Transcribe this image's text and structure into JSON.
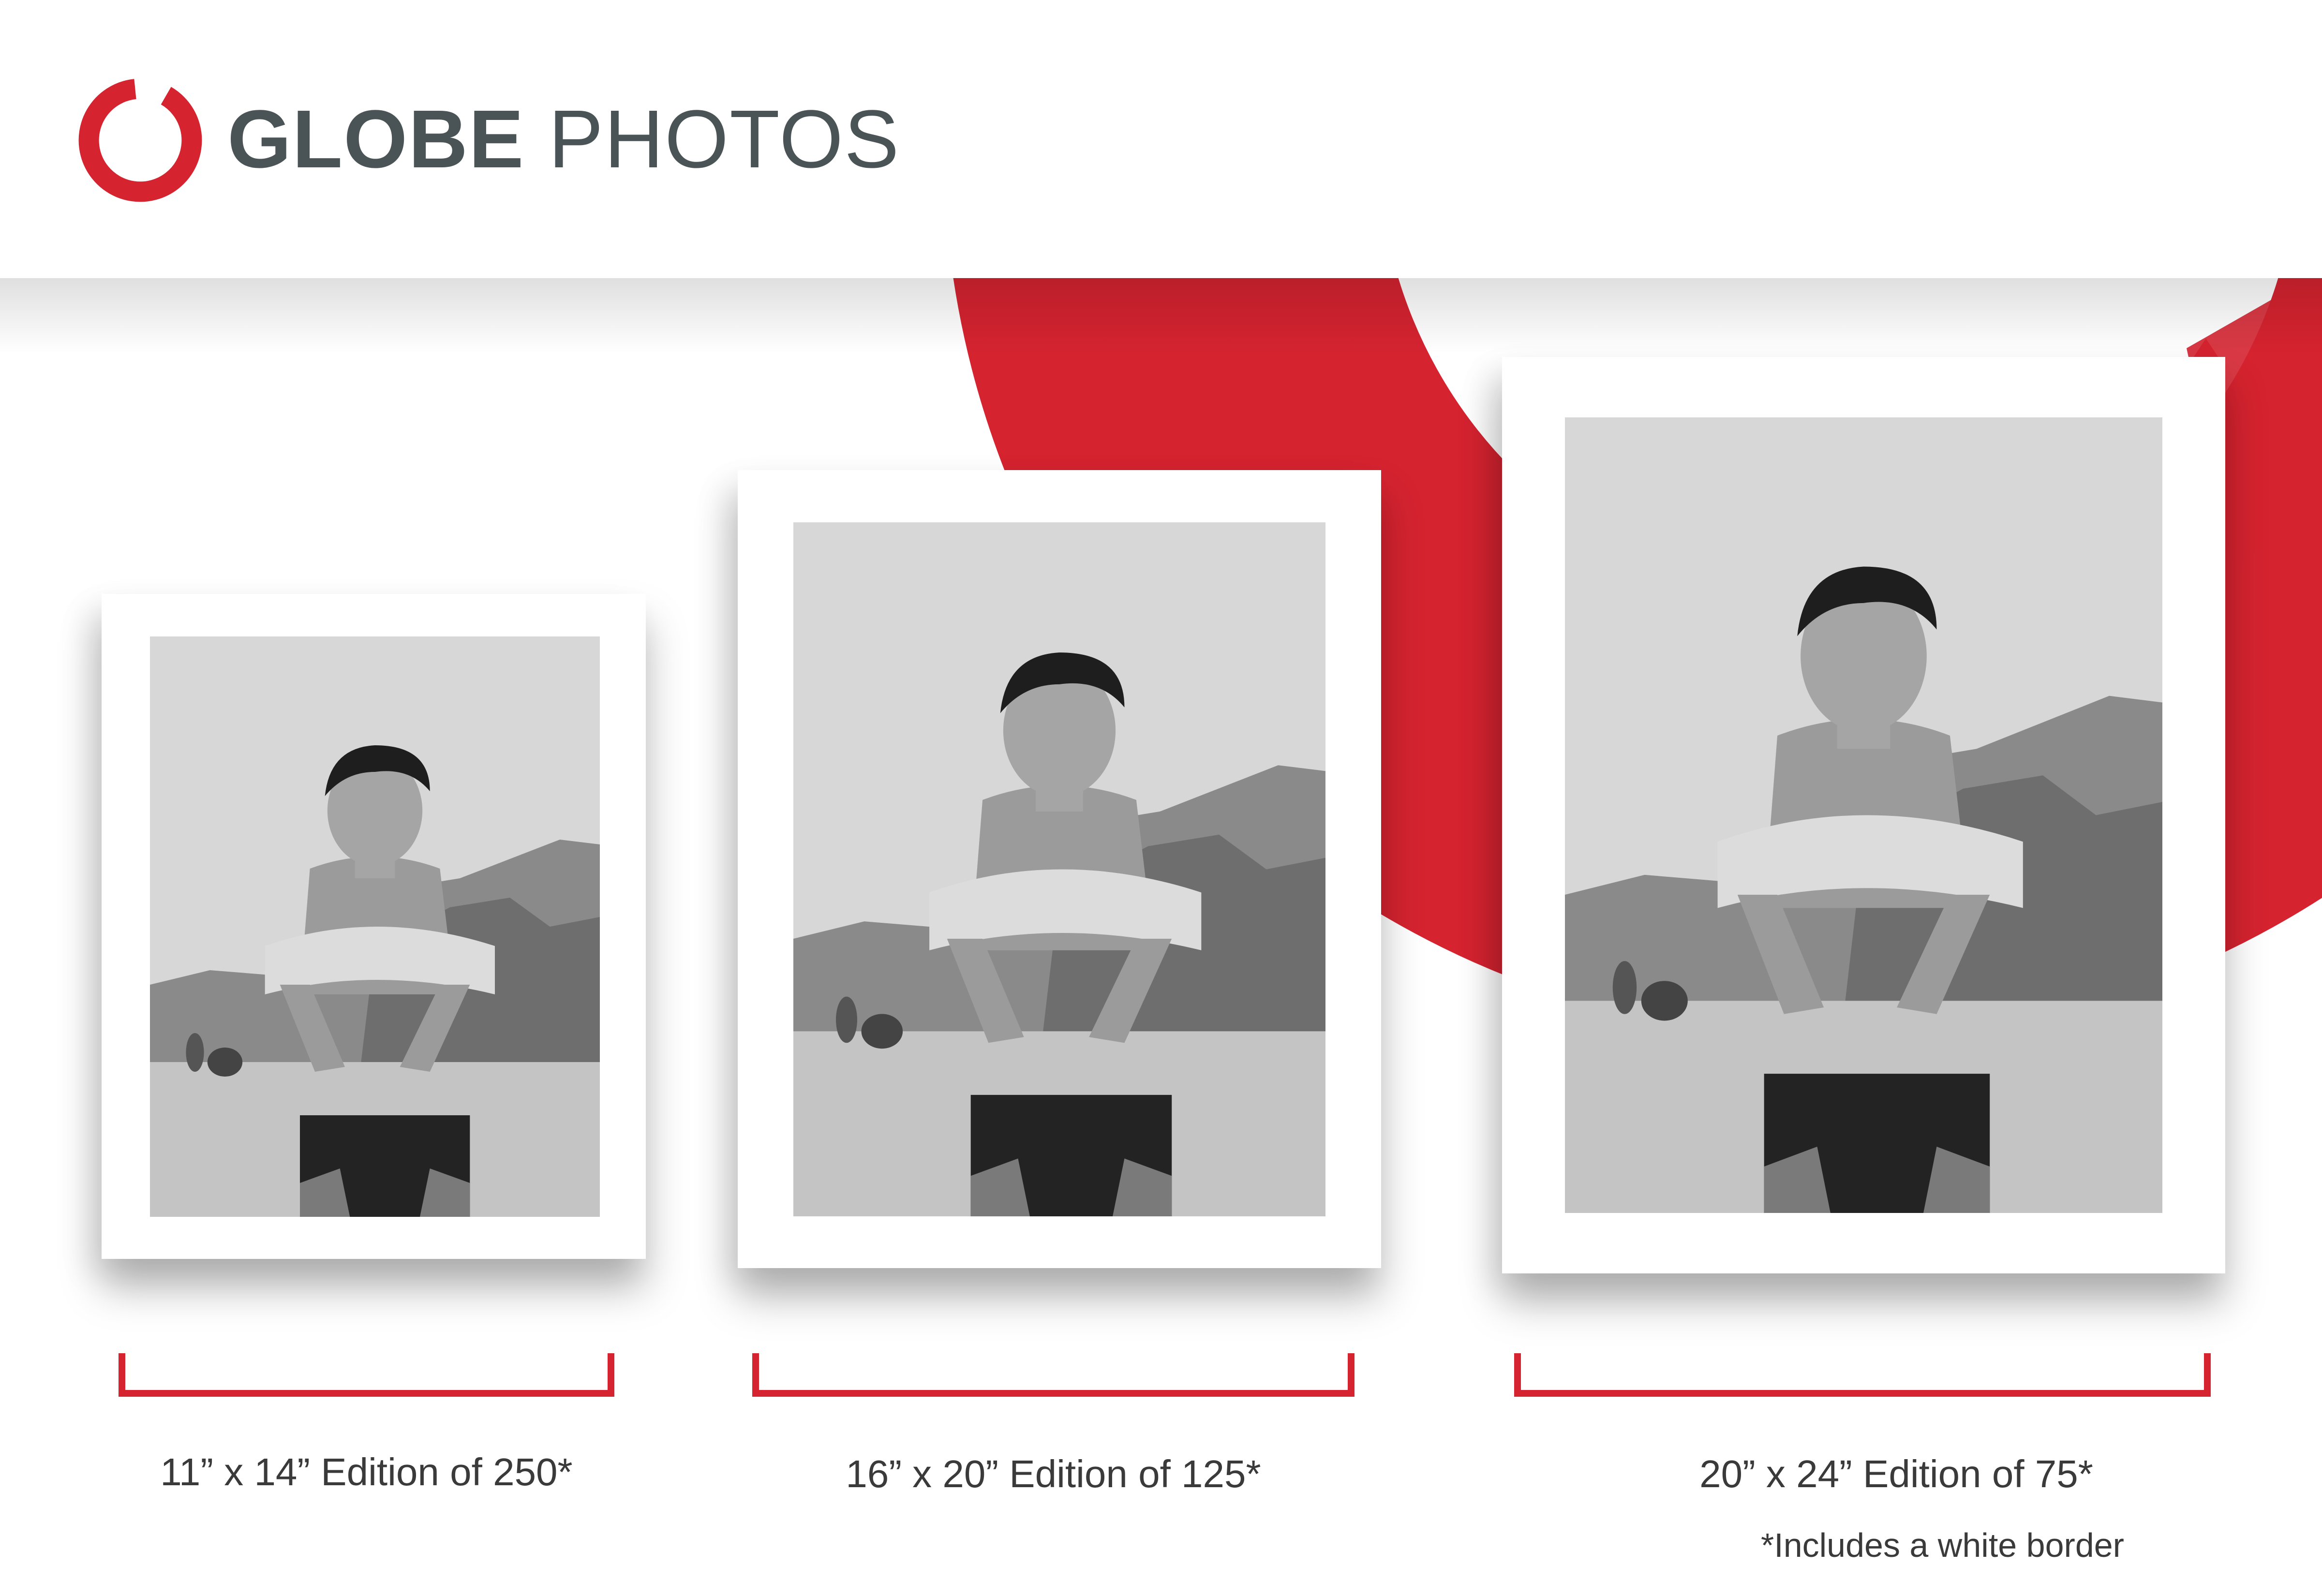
{
  "brand": {
    "name_bold": "GLOBE",
    "name_light": "PHOTOS",
    "accent_color": "#d52330",
    "text_color": "#4a5457",
    "logo_icon": "brush-circle-icon"
  },
  "prints": [
    {
      "caption": "11” x 14” Edition of 250*"
    },
    {
      "caption": "16” x 20” Edition of 125*"
    },
    {
      "caption": "20” x 24” Edition of 75*"
    }
  ],
  "footnote": "*Includes a white border",
  "photo_subject": "black-and-white beach portrait"
}
